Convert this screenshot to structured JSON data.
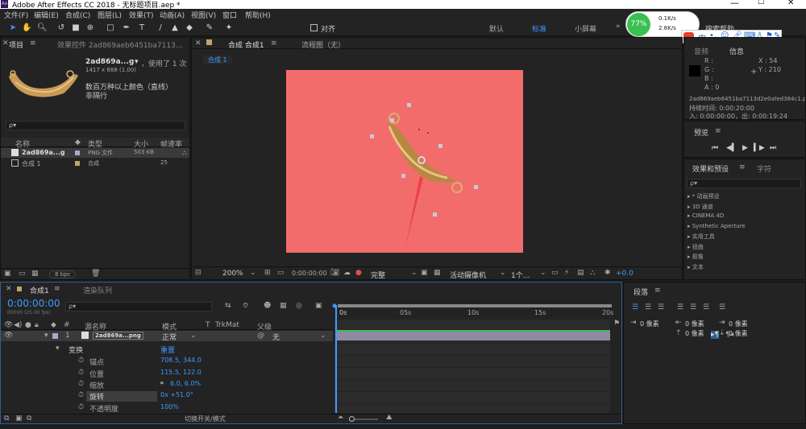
{
  "window": {
    "title": "Adobe After Effects CC 2018 - 无标题项目.aep *",
    "app_badge": "Ae"
  },
  "menu": [
    "文件(F)",
    "编辑(E)",
    "合成(C)",
    "图层(L)",
    "效果(T)",
    "动画(A)",
    "视图(V)",
    "窗口",
    "帮助(H)"
  ],
  "toolbar": {
    "snap_label": "对齐",
    "workspaces": [
      "默认",
      "标准",
      "小屏幕"
    ],
    "search_help": "搜索帮助"
  },
  "net_widget": {
    "percent": "77%",
    "up": "0.1K/s",
    "down": "2.8K/s"
  },
  "project": {
    "tab_project": "项目",
    "tab_effect": "效果控件 2ad869aeb6451ba7113…",
    "asset_name": "2ad869a...g",
    "asset_used": "，使用了 1 次",
    "asset_dims": "1417 x 688 (1.00)",
    "asset_desc1": "数百万种以上颜色（直线）",
    "asset_desc2": "非隔行",
    "search_placeholder": "ρ▾",
    "columns": [
      "名称",
      "类型",
      "大小",
      "帧速率"
    ],
    "items": [
      {
        "name": "2ad869a...g",
        "type": "PNG 文件",
        "size": "503 KB",
        "fps": ""
      },
      {
        "name": "合成 1",
        "type": "合成",
        "size": "",
        "fps": "25"
      }
    ],
    "bpc": "8 bpc"
  },
  "composition": {
    "tab_comp": "合成 合成1",
    "tab_flow": "流程图（无）",
    "subtab": "合成 1",
    "canvas_color": "#f36c6c",
    "zoom": "200%",
    "timecode": "0:00:00:00",
    "quality": "完整",
    "camera": "活动摄像机",
    "views": "1个...",
    "exposure": "+0.0"
  },
  "info": {
    "tab_info": "信息",
    "tab_audio": "音频",
    "r": "R :",
    "g": "G :",
    "b": "B :",
    "a": "A : 0",
    "x": "X : 54",
    "y": "Y : 210",
    "file": "2ad869aeb6451ba7113d2e0afed384c1.png",
    "duration": "持续时间: 0:00:20:00",
    "inout": "入: 0:00:00:00，出: 0:00:19:24"
  },
  "preview": {
    "title": "预览"
  },
  "effects": {
    "tab_effects": "效果和预设",
    "tab_chars": "字符",
    "search_placeholder": "ρ▾",
    "items": [
      "▸ * 动画预设",
      "▸ 3D 通道",
      "▸ CINEMA 4D",
      "▸ Synthetic Aperture",
      "▸ 实用工具",
      "▸ 扭曲",
      "▸ 抠像",
      "▸ 文本"
    ]
  },
  "paragraph": {
    "title": "段落",
    "fields": [
      "0 像素",
      "0 像素",
      "0 像素",
      "0 像素",
      "0 像素"
    ]
  },
  "timeline": {
    "tab_comp": "合成1",
    "tab_render": "渲染队列",
    "timecode": "0:00:00:00",
    "fps_note": "00000 (25.00 fps)",
    "search_placeholder": "ρ▾",
    "col_num": "#",
    "col_source": "源名称",
    "col_mode": "模式",
    "col_t": "T",
    "col_trkmat": "TrkMat",
    "col_parent": "父级",
    "layer": {
      "num": "1",
      "name": "2ad869a...png",
      "mode": "正常",
      "parent": "无"
    },
    "transform": "变换",
    "reset": "重置",
    "props": [
      {
        "name": "锚点",
        "value": "708.5, 344.0"
      },
      {
        "name": "位置",
        "value": "115.5, 122.0"
      },
      {
        "name": "缩放",
        "value": "6.0, 6.0%"
      },
      {
        "name": "旋转",
        "value": "0x +51.0°"
      },
      {
        "name": "不透明度",
        "value": "100%"
      }
    ],
    "ticks": [
      "0s",
      "05s",
      "10s",
      "15s",
      "20s"
    ],
    "bottom": "切换开关/模式"
  }
}
